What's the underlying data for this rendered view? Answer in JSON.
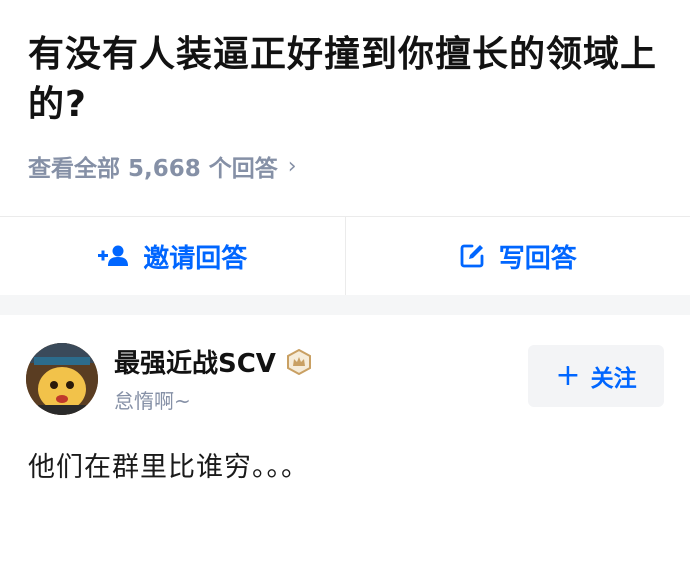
{
  "question": {
    "title": "有没有人装逼正好撞到你擅长的领域上的?",
    "view_all_label": "查看全部 5,668 个回答",
    "chevron_icon": "chevron-right-icon"
  },
  "actions": {
    "invite_label": "邀请回答",
    "invite_icon": "add-user-icon",
    "write_label": "写回答",
    "write_icon": "edit-icon"
  },
  "answer": {
    "author_name": "最强近战SCV",
    "author_bio": "怠惰啊~",
    "badge_icon": "crown-badge-icon",
    "follow_label": "关注",
    "text": "他们在群里比谁穷。。。"
  },
  "colors": {
    "accent": "#0066ff",
    "muted": "#8590a6",
    "badge": "#c9a063",
    "section_gap": "#f5f6f7"
  }
}
